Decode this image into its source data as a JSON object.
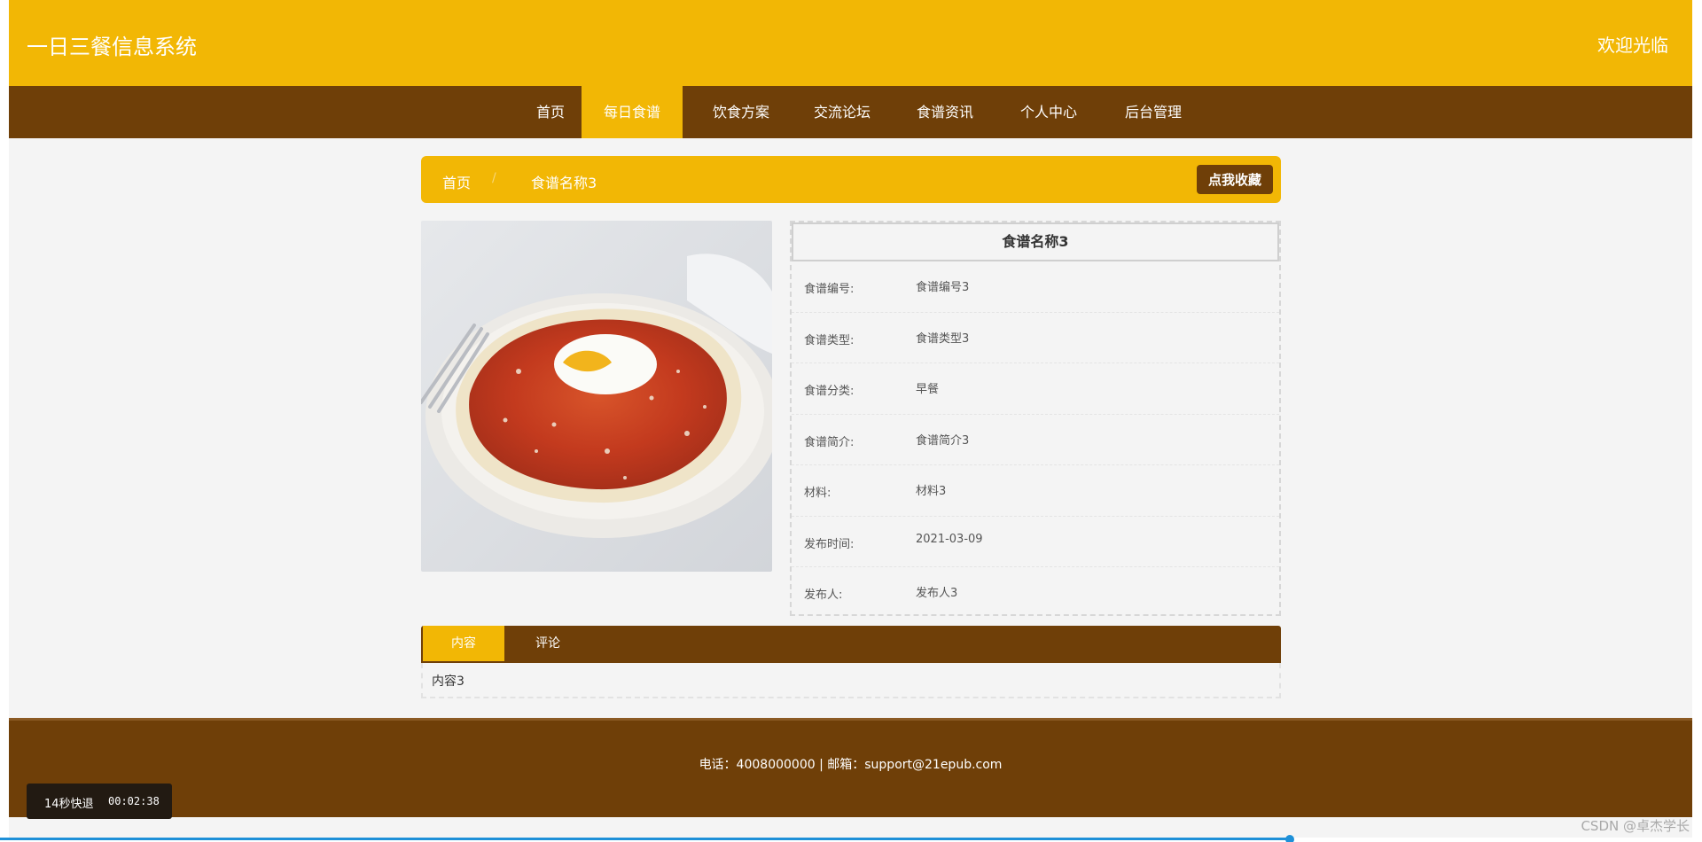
{
  "header": {
    "site_title": "一日三餐信息系统",
    "welcome": "欢迎光临"
  },
  "nav": {
    "items": [
      "首页",
      "每日食谱",
      "饮食方案",
      "交流论坛",
      "食谱资讯",
      "个人中心",
      "后台管理"
    ],
    "active_index": 1
  },
  "breadcrumb": {
    "home": "首页",
    "separator": "/",
    "current": "食谱名称3"
  },
  "favorite_button": "点我收藏",
  "recipe": {
    "title": "食谱名称3",
    "fields": [
      {
        "label": "食谱编号:",
        "value": "食谱编号3"
      },
      {
        "label": "食谱类型:",
        "value": "食谱类型3"
      },
      {
        "label": "食谱分类:",
        "value": "早餐"
      },
      {
        "label": "食谱简介:",
        "value": "食谱简介3"
      },
      {
        "label": "材料:",
        "value": "材料3"
      },
      {
        "label": "发布时间:",
        "value": "2021-03-09"
      },
      {
        "label": "发布人:",
        "value": "发布人3"
      }
    ]
  },
  "tabs": {
    "items": [
      "内容",
      "评论"
    ],
    "active_index": 0,
    "content": "内容3"
  },
  "footer": {
    "contact": "电话：4008000000 | 邮箱：support@21epub.com"
  },
  "video_player": {
    "skip_label": "14秒快退",
    "time": "00:02:38",
    "progress": 0.758
  },
  "watermark": "CSDN @卓杰学长",
  "colors": {
    "primary_yellow": "#f2b705",
    "brown": "#6f3f08",
    "background": "#f4f4f4",
    "progress_blue": "#1e90d8"
  }
}
